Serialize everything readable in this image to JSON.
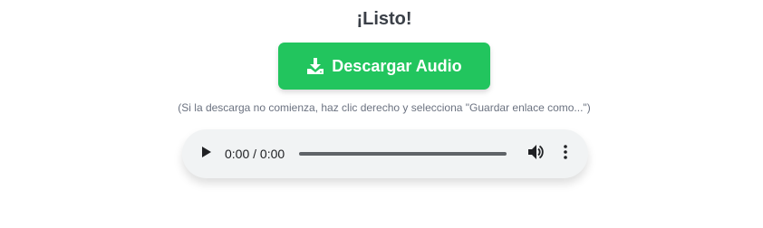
{
  "heading": "¡Listo!",
  "download_button": {
    "label": "Descargar Audio",
    "icon": "download-icon",
    "color": "#22c55e"
  },
  "hint": "(Si la descarga no comienza, haz clic derecho y selecciona \"Guardar enlace como...\")",
  "audio_player": {
    "time": "0:00 / 0:00",
    "play_icon": "play-icon",
    "volume_icon": "volume-icon",
    "menu_icon": "more-vert-icon",
    "progress": 0
  }
}
